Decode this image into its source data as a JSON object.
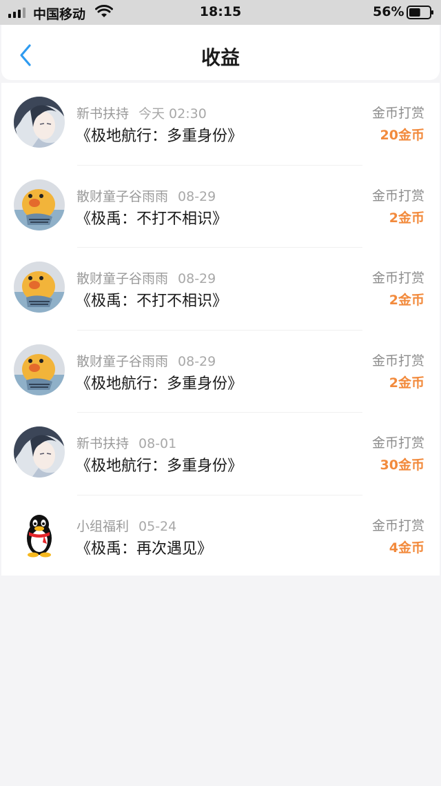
{
  "status_bar": {
    "carrier": "中国移动",
    "time": "18:15",
    "battery": "56%",
    "battery_level": 0.56
  },
  "header": {
    "title": "收益",
    "back_icon": "chevron-left-icon",
    "accent_color": "#2e9bf0"
  },
  "items": [
    {
      "avatar": "anime-boy-avatar",
      "source": "新书扶持",
      "date": "今天 02:30",
      "book": "《极地航行：多重身份》",
      "type": "金币打赏",
      "amount": "20金币"
    },
    {
      "avatar": "duck-avatar",
      "source": "散财童子谷雨雨",
      "date": "08-29",
      "book": "《极禹：不打不相识》",
      "type": "金币打赏",
      "amount": "2金币"
    },
    {
      "avatar": "duck-avatar",
      "source": "散财童子谷雨雨",
      "date": "08-29",
      "book": "《极禹：不打不相识》",
      "type": "金币打赏",
      "amount": "2金币"
    },
    {
      "avatar": "duck-avatar",
      "source": "散财童子谷雨雨",
      "date": "08-29",
      "book": "《极地航行：多重身份》",
      "type": "金币打赏",
      "amount": "2金币"
    },
    {
      "avatar": "anime-boy-avatar",
      "source": "新书扶持",
      "date": "08-01",
      "book": "《极地航行：多重身份》",
      "type": "金币打赏",
      "amount": "30金币"
    },
    {
      "avatar": "penguin-avatar",
      "source": "小组福利",
      "date": "05-24",
      "book": "《极禹：再次遇见》",
      "type": "金币打赏",
      "amount": "4金币"
    }
  ],
  "colors": {
    "amount": "#f28a3c",
    "meta_text": "#9a9a9a",
    "background": "#f4f4f6"
  }
}
